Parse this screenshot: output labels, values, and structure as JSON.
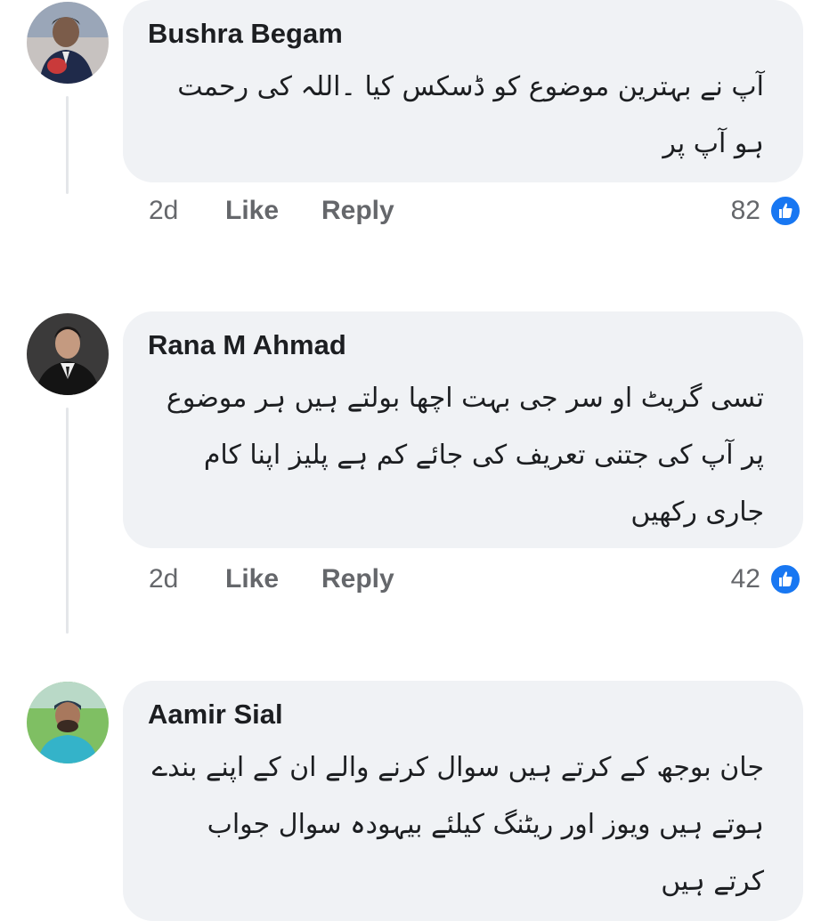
{
  "comments": [
    {
      "author": "Bushra Begam",
      "text": "آپ نے بہترین موضوع کو ڈسکس کیا ۔اللہ کی رحمت ہو آپ پر",
      "time": "2d",
      "like_label": "Like",
      "reply_label": "Reply",
      "reaction_count": "82",
      "reaction_icon": "like-icon"
    },
    {
      "author": "Rana M Ahmad",
      "text": "تسی گریٹ او سر جی بہت اچھا بولتے ہیں ہر موضوع پر آپ کی جتنی تعریف کی جائے کم ہے پلیز اپنا کام جاری رکھیں",
      "time": "2d",
      "like_label": "Like",
      "reply_label": "Reply",
      "reaction_count": "42",
      "reaction_icon": "like-icon"
    },
    {
      "author": "Aamir Sial",
      "text": "جان بوجھ کے کرتے ہیں سوال کرنے والے ان کے اپنے بندے ہوتے ہیں ویوز اور ریٹنگ کیلئے بیہودہ سوال جواب کرتے ہیں"
    }
  ],
  "colors": {
    "bubble": "#f0f2f5",
    "author_text": "#1c1e21",
    "meta_text": "#65676b",
    "like_blue": "#1877f2",
    "thread_line": "#e4e6e9"
  }
}
